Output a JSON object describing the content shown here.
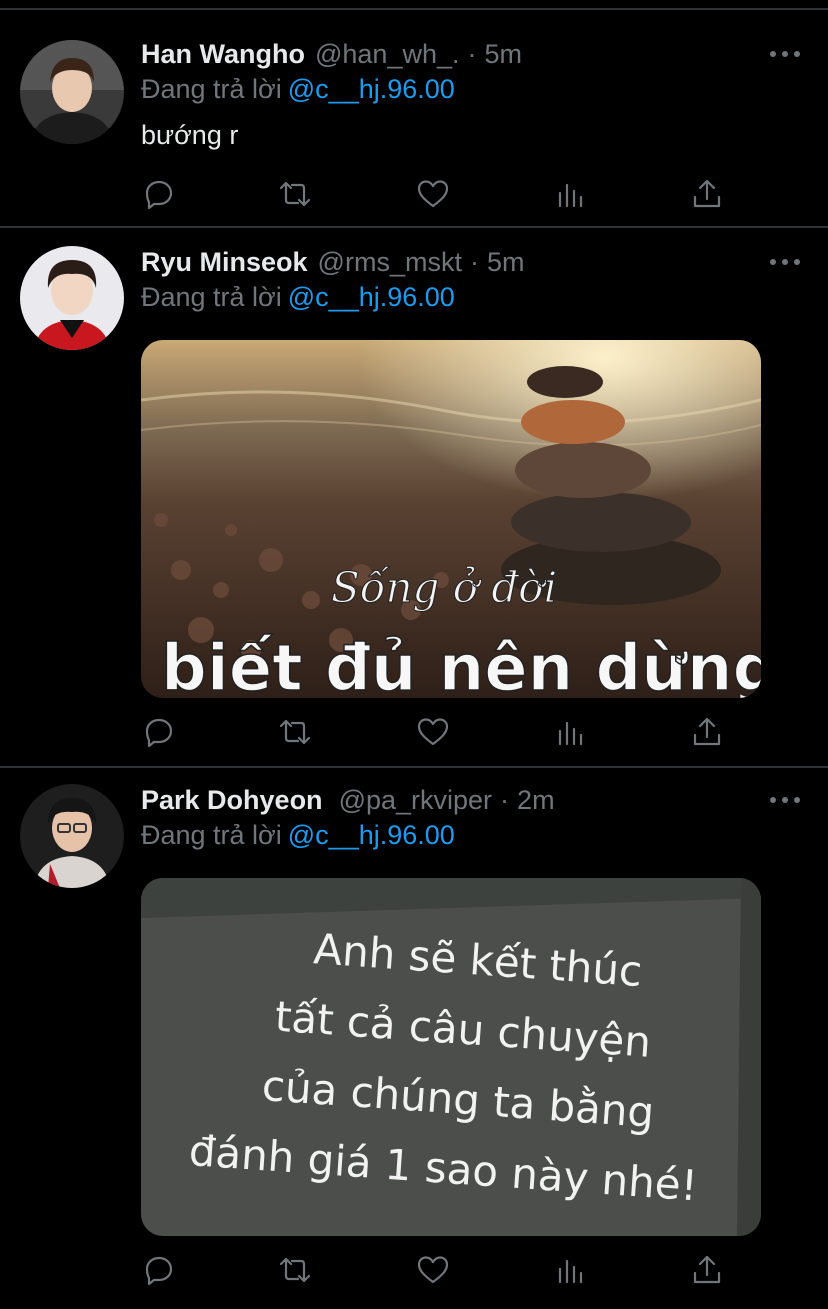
{
  "reply_prefix": "Đang trả lời",
  "tweets": [
    {
      "name": "Han Wangho",
      "handle": "@han_wh_.",
      "time": "5m",
      "reply_to": "@c__hj.96.00",
      "text": "bướng r"
    },
    {
      "name": "Ryu Minseok",
      "handle": "@rms_mskt",
      "time": "5m",
      "reply_to": "@c__hj.96.00",
      "image_text": {
        "line1": "Sống ở đời",
        "line2": "biết đủ nên dừng"
      }
    },
    {
      "name": "Park Dohyeon",
      "handle": "@pa_rkviper",
      "time": "2m",
      "reply_to": "@c__hj.96.00",
      "image_text": {
        "line1": "Anh sẽ kết thúc",
        "line2": "tất cả câu chuyện",
        "line3": "của chúng ta bằng",
        "line4": "đánh giá 1 sao này nhé!"
      }
    }
  ],
  "icons": [
    "reply-icon",
    "retweet-icon",
    "like-icon",
    "analytics-icon",
    "share-icon",
    "more-icon"
  ],
  "colors": {
    "background": "#000000",
    "text": "#e7e9ea",
    "muted": "#71767b",
    "link": "#1d9bf0",
    "divider": "#2f3336"
  }
}
